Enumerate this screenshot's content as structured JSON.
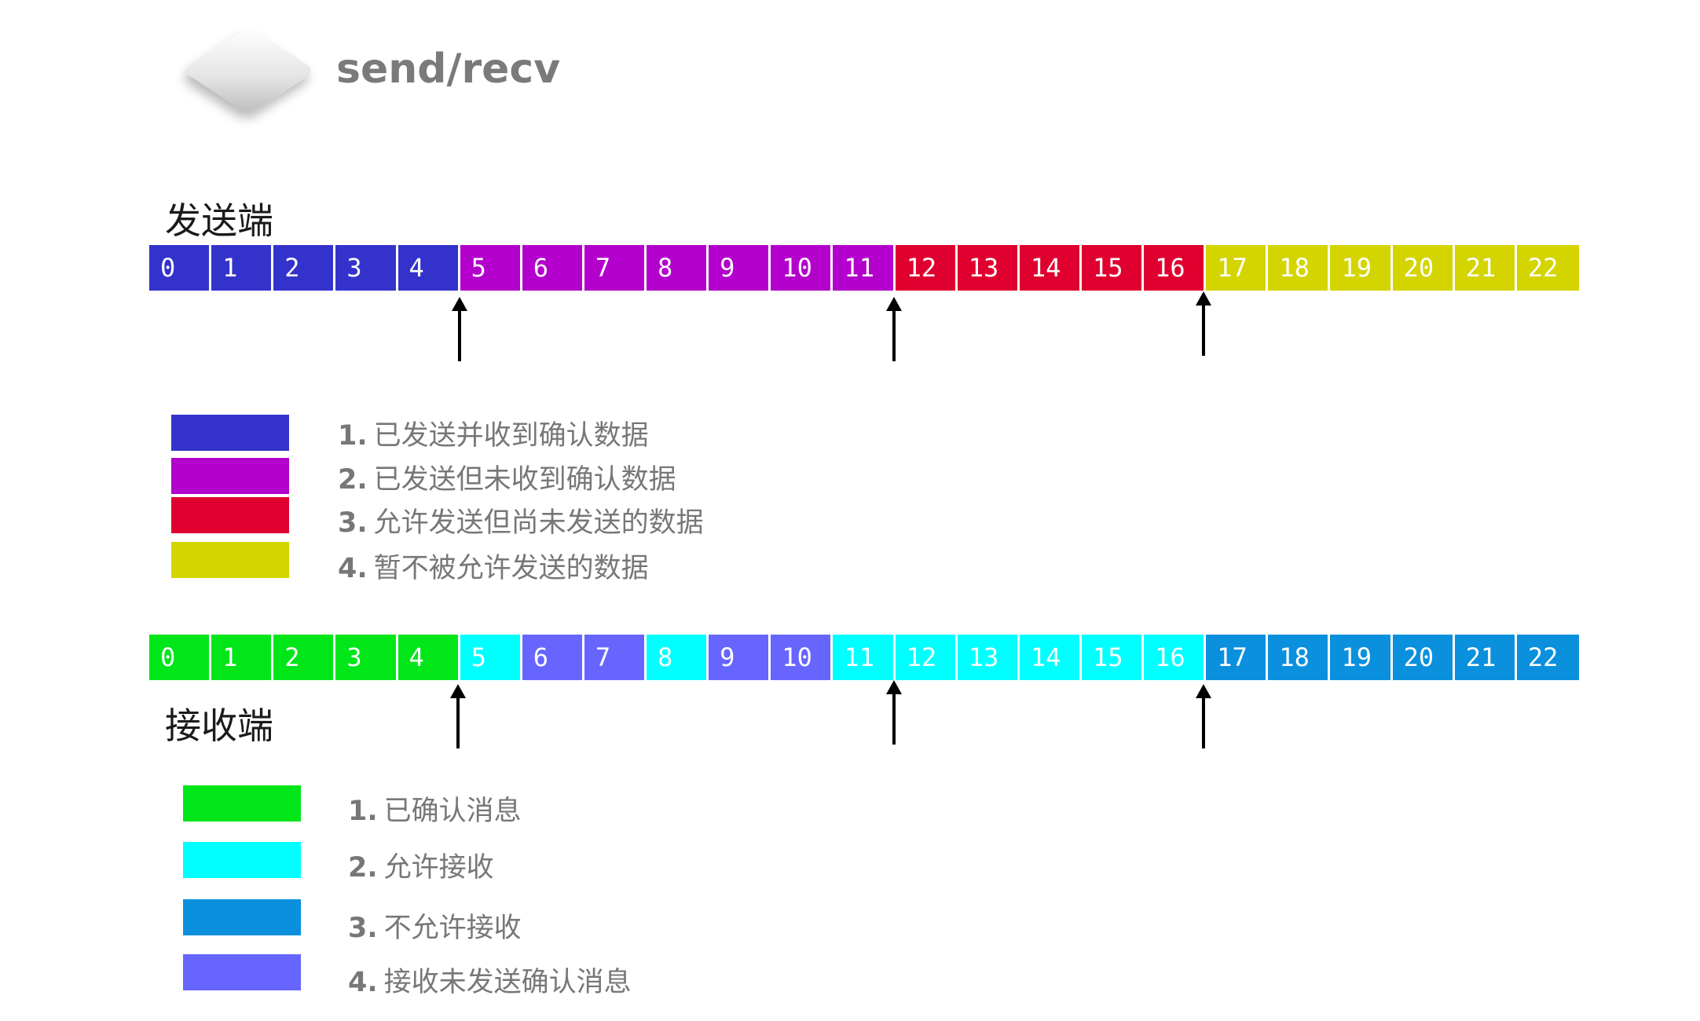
{
  "title": "send/recv",
  "sender": {
    "label": "发送端",
    "cells": [
      {
        "text": "0",
        "color": "#3333cc"
      },
      {
        "text": "1",
        "color": "#3333cc"
      },
      {
        "text": "2",
        "color": "#3333cc"
      },
      {
        "text": "3",
        "color": "#3333cc"
      },
      {
        "text": "4",
        "color": "#3333cc"
      },
      {
        "text": "5",
        "color": "#b300cc"
      },
      {
        "text": "6",
        "color": "#b300cc"
      },
      {
        "text": "7",
        "color": "#b300cc"
      },
      {
        "text": "8",
        "color": "#b300cc"
      },
      {
        "text": "9",
        "color": "#b300cc"
      },
      {
        "text": "10",
        "color": "#b300cc"
      },
      {
        "text": "11",
        "color": "#b300cc"
      },
      {
        "text": "12",
        "color": "#e00030"
      },
      {
        "text": "13",
        "color": "#e00030"
      },
      {
        "text": "14",
        "color": "#e00030"
      },
      {
        "text": "15",
        "color": "#e00030"
      },
      {
        "text": "16",
        "color": "#e00030"
      },
      {
        "text": "17",
        "color": "#d4d400"
      },
      {
        "text": "18",
        "color": "#d4d400"
      },
      {
        "text": "19",
        "color": "#d4d400"
      },
      {
        "text": "20",
        "color": "#d4d400"
      },
      {
        "text": "21",
        "color": "#d4d400"
      },
      {
        "text": "22",
        "color": "#d4d400"
      }
    ],
    "legend": [
      {
        "num": "1.",
        "text": "已发送并收到确认数据",
        "color": "#3333cc"
      },
      {
        "num": "2.",
        "text": "已发送但未收到确认数据",
        "color": "#b300cc"
      },
      {
        "num": "3.",
        "text": "允许发送但尚未发送的数据",
        "color": "#e00030"
      },
      {
        "num": "4.",
        "text": "暂不被允许发送的数据",
        "color": "#d4d400"
      }
    ]
  },
  "receiver": {
    "label": "接收端",
    "cells": [
      {
        "text": "0",
        "color": "#00e619"
      },
      {
        "text": "1",
        "color": "#00e619"
      },
      {
        "text": "2",
        "color": "#00e619"
      },
      {
        "text": "3",
        "color": "#00e619"
      },
      {
        "text": "4",
        "color": "#00e619"
      },
      {
        "text": "5",
        "color": "#00ffff"
      },
      {
        "text": "6",
        "color": "#6666ff"
      },
      {
        "text": "7",
        "color": "#6666ff"
      },
      {
        "text": "8",
        "color": "#00ffff"
      },
      {
        "text": "9",
        "color": "#6666ff"
      },
      {
        "text": "10",
        "color": "#6666ff"
      },
      {
        "text": "11",
        "color": "#00ffff"
      },
      {
        "text": "12",
        "color": "#00ffff"
      },
      {
        "text": "13",
        "color": "#00ffff"
      },
      {
        "text": "14",
        "color": "#00ffff"
      },
      {
        "text": "15",
        "color": "#00ffff"
      },
      {
        "text": "16",
        "color": "#00ffff"
      },
      {
        "text": "17",
        "color": "#0a90dd"
      },
      {
        "text": "18",
        "color": "#0a90dd"
      },
      {
        "text": "19",
        "color": "#0a90dd"
      },
      {
        "text": "20",
        "color": "#0a90dd"
      },
      {
        "text": "21",
        "color": "#0a90dd"
      },
      {
        "text": "22",
        "color": "#0a90dd"
      }
    ],
    "legend": [
      {
        "num": "1.",
        "text": "已确认消息",
        "color": "#00e619"
      },
      {
        "num": "2.",
        "text": "允许接收",
        "color": "#00ffff"
      },
      {
        "num": "3.",
        "text": "不允许接收",
        "color": "#0a90dd"
      },
      {
        "num": "4.",
        "text": "接收未发送确认消息",
        "color": "#6666ff"
      }
    ]
  }
}
